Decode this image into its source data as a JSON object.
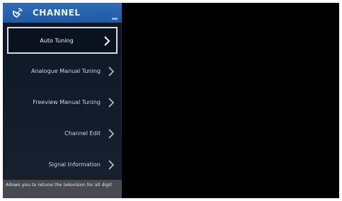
{
  "header": {
    "title": "CHANNEL",
    "icon": "satellite-dish-icon"
  },
  "menu": {
    "items": [
      {
        "label": "Auto Tuning",
        "focused": true
      },
      {
        "label": "Analogue Manual Tuning",
        "focused": false
      },
      {
        "label": "Freeview Manual Tuning",
        "focused": false
      },
      {
        "label": "Channel Edit",
        "focused": false
      },
      {
        "label": "Signal Information",
        "focused": false
      }
    ]
  },
  "hint": {
    "text": "Allows you to retune the television for all digit"
  },
  "colors": {
    "header_bg": "#1e5aa6",
    "panel_bg": "#121c2b",
    "focus_border": "#d8dde3",
    "hint_bg": "#474a50",
    "screen_bg": "#000000"
  }
}
